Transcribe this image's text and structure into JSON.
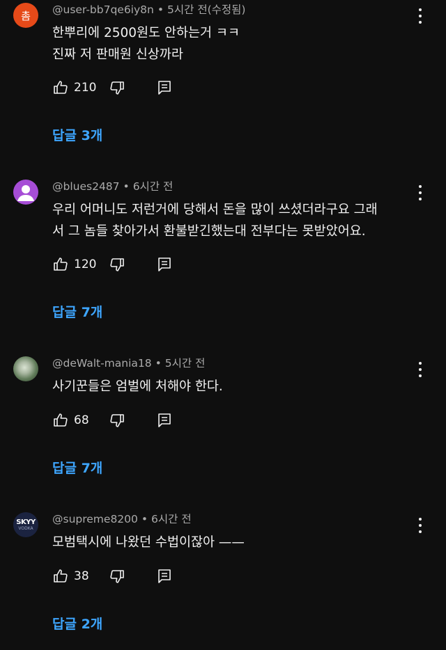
{
  "comments": [
    {
      "avatar_letter": "촘",
      "avatar_color": "#e64a19",
      "author": "@user-bb7qe6iy8n",
      "time": "5시간 전(수정됨)",
      "lines": [
        "한뿌리에 2500원도 안하는거 ㅋㅋ",
        "진짜 저 판매원 신상까라"
      ],
      "likes": "210",
      "replies_label": "답글 3개"
    },
    {
      "avatar_color": "#a64dd6",
      "author": "@blues2487",
      "time": "6시간 전",
      "lines": [
        "우리 어머니도 저런거에 당해서 돈을 많이 쓰셨더라구요 그래",
        "서 그 놈들 찾아가서 환불받긴했는대 전부다는 못받았어요."
      ],
      "likes": "120",
      "replies_label": "답글 7개"
    },
    {
      "author": "@deWalt-mania18",
      "time": "5시간 전",
      "lines": [
        "사기꾼들은 엄벌에 처해야 한다."
      ],
      "likes": "68",
      "replies_label": "답글 7개"
    },
    {
      "avatar_text": "SKYY",
      "avatar_subtext": "VODKA",
      "author": "@supreme8200",
      "time": "6시간 전",
      "lines": [
        "모범택시에 나왔던 수법이잖아 ——"
      ],
      "likes": "38",
      "replies_label": "답글 2개"
    }
  ],
  "separator": "•",
  "icons": {
    "like": "thumbs-up-icon",
    "dislike": "thumbs-down-icon",
    "reply": "reply-icon",
    "menu": "more-vert-icon"
  },
  "colors": {
    "background": "#0f0f0f",
    "meta_text": "#aaaaaa",
    "body_text": "#f1f1f1",
    "link": "#3ea6ff"
  }
}
